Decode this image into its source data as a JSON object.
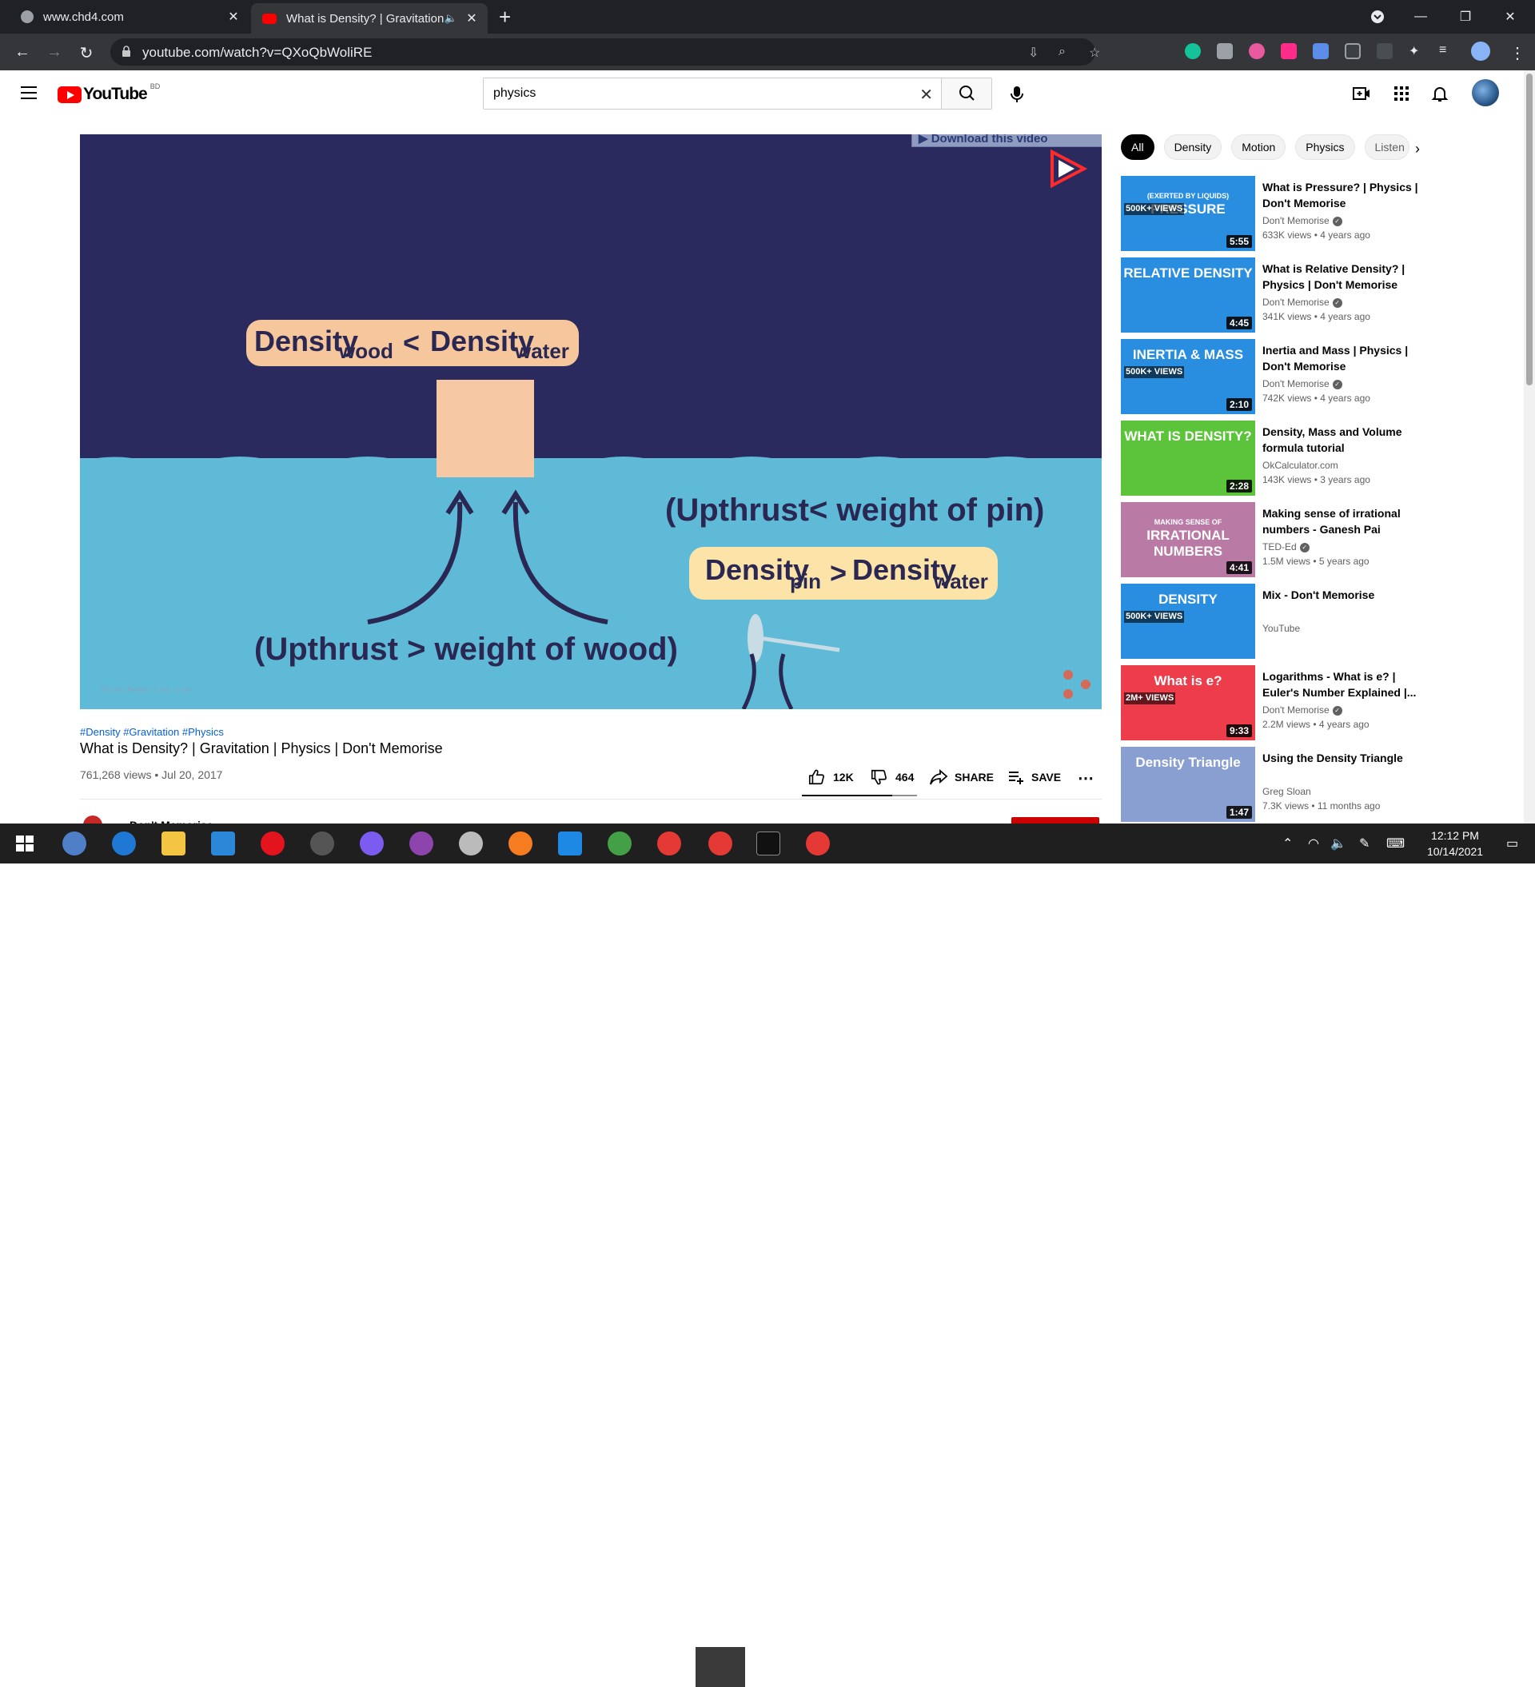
{
  "browser": {
    "tabs": [
      {
        "title": "www.chd4.com",
        "active": false
      },
      {
        "title": "What is Density? | Gravitation",
        "active": true
      }
    ],
    "url": "youtube.com/watch?v=QXoQbWoliRE"
  },
  "youtube": {
    "logo_text": "YouTube",
    "country_code": "BD",
    "search_value": "physics",
    "search_placeholder": "Search"
  },
  "video": {
    "download_overlay": "▶ Download this video",
    "bubble_wood": {
      "left": "Density",
      "sub_left": "wood",
      "op": "<",
      "right": "Density",
      "sub_right": "water"
    },
    "bubble_pin": {
      "left": "Density",
      "sub_left": "pin",
      "op": ">",
      "right": "Density",
      "sub_right": "water"
    },
    "caption_pin": "(Upthrust< weight of pin)",
    "caption_wood": "(Upthrust > weight of wood)",
    "watermark": "©DontMemorise.com",
    "hashtags": "#Density #Gravitation #Physics",
    "title": "What is Density? | Gravitation | Physics | Don't Memorise",
    "views_date": "761,268 views • Jul 20, 2017",
    "likes": "12K",
    "dislikes": "464",
    "share_label": "SHARE",
    "save_label": "SAVE",
    "like_ratio": 0.785,
    "channel_peek": "Don't Memorise"
  },
  "chips": [
    "All",
    "Density",
    "Motion",
    "Physics",
    "Listen"
  ],
  "recommendations": [
    {
      "thumb_text": "PRESSURE",
      "thumb_sub": "(EXERTED BY LIQUIDS)",
      "badge": "500K+ VIEWS",
      "duration": "5:55",
      "title": "What is Pressure? | Physics | Don't Memorise",
      "channel": "Don't Memorise",
      "verified": true,
      "stats": "633K views • 4 years ago",
      "bg": "#2a8ee0"
    },
    {
      "thumb_text": "RELATIVE DENSITY",
      "thumb_sub": "",
      "badge": "",
      "duration": "4:45",
      "title": "What is Relative Density? | Physics | Don't Memorise",
      "channel": "Don't Memorise",
      "verified": true,
      "stats": "341K views • 4 years ago",
      "bg": "#2a8ee0"
    },
    {
      "thumb_text": "INERTIA & MASS",
      "thumb_sub": "",
      "badge": "500K+ VIEWS",
      "duration": "2:10",
      "title": "Inertia and Mass | Physics | Don't Memorise",
      "channel": "Don't Memorise",
      "verified": true,
      "stats": "742K views • 4 years ago",
      "bg": "#2a8ee0"
    },
    {
      "thumb_text": "WHAT IS DENSITY?",
      "thumb_sub": "",
      "badge": "",
      "duration": "2:28",
      "title": "Density, Mass and Volume formula tutorial",
      "channel": "OkCalculator.com",
      "verified": false,
      "stats": "143K views • 3 years ago",
      "bg": "#5cc43a"
    },
    {
      "thumb_text": "IRRATIONAL NUMBERS",
      "thumb_sub": "MAKING SENSE OF",
      "badge": "",
      "duration": "4:41",
      "title": "Making sense of irrational numbers - Ganesh Pai",
      "channel": "TED-Ed",
      "verified": true,
      "stats": "1.5M views • 5 years ago",
      "bg": "#b97aa6"
    },
    {
      "thumb_text": "DENSITY",
      "thumb_sub": "",
      "badge": "500K+ VIEWS",
      "duration": "",
      "title": "Mix - Don't Memorise",
      "channel": "YouTube",
      "verified": false,
      "stats": "",
      "bg": "#2a8ee0"
    },
    {
      "thumb_text": "What is e?",
      "thumb_sub": "",
      "badge": "2M+ VIEWS",
      "duration": "9:33",
      "title": "Logarithms - What is e? | Euler's Number Explained |...",
      "channel": "Don't Memorise",
      "verified": true,
      "stats": "2.2M views • 4 years ago",
      "bg": "#ee3d4a"
    },
    {
      "thumb_text": "Density Triangle",
      "thumb_sub": "",
      "badge": "",
      "duration": "1:47",
      "title": "Using the Density Triangle",
      "channel": "Greg Sloan",
      "verified": false,
      "stats": "7.3K views • 11 months ago",
      "bg": "#8a9fd1"
    }
  ],
  "taskbar": {
    "time": "12:12 PM",
    "date": "10/14/2021"
  }
}
